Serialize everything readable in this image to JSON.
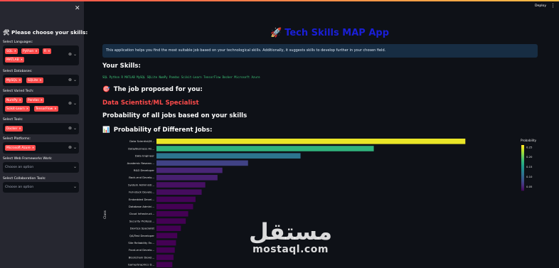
{
  "sidebar": {
    "close": "✕",
    "title_icon": "🛠",
    "title": "Please choose your skills:",
    "sections": [
      {
        "label": "Select Languages:",
        "tags": [
          "SQL",
          "Python",
          "R",
          "MATLAB"
        ]
      },
      {
        "label": "Select Databases:",
        "tags": [
          "MySQL",
          "SQLite"
        ]
      },
      {
        "label": "Select Varied Tech:",
        "tags": [
          "NumPy",
          "Pandas",
          "Scikit-Learn",
          "TensorFlow"
        ]
      },
      {
        "label": "Select Tools:",
        "tags": [
          "Docker"
        ]
      },
      {
        "label": "Select Platforms:",
        "tags": [
          "Microsoft Azure"
        ]
      },
      {
        "label": "Select Web Frameworks Work:",
        "placeholder": "Choose an option"
      },
      {
        "label": "Select Collaboration Tools:",
        "placeholder": "Choose an option"
      }
    ]
  },
  "header": {
    "deploy": "Deploy",
    "menu": "⋮"
  },
  "main": {
    "title_icon": "🚀",
    "title": "Tech Skills MAP App",
    "info": "This application helps you find the most suitable job based on your technological skills. Additionally, it suggests skills to develop further in your chosen field.",
    "your_skills_heading": "Your Skills:",
    "skills_line": "SQL  Python  R  MATLAB  MySQL  SQLite  NumPy  Pandas  Scikit-Learn  TensorFlow  Docker  Microsoft Azure",
    "proposed_icon": "🎯",
    "proposed_heading": "The job proposed for you:",
    "proposed_job": "Data Scientist/ML Specialist",
    "prob_heading": "Probability of all jobs based on your skills",
    "chart_icon": "📊",
    "chart_heading": "Probability of Different Jobs:"
  },
  "watermark": {
    "arabic": "مستقل",
    "latin": "mostaql.com"
  },
  "chart_data": {
    "type": "bar",
    "orientation": "horizontal",
    "ylabel": "Class",
    "legend_title": "Probability",
    "colorbar_ticks": [
      0.25,
      0.2,
      0.15,
      0.1,
      0.05
    ],
    "colorbar_labels": [
      "0.25",
      "0.20",
      "0.15",
      "0.10",
      "0.05"
    ],
    "colorbar_range": [
      0.03,
      0.26
    ],
    "xlim": [
      0,
      0.3
    ],
    "categories": [
      "Data Scientist/M...",
      "Data/Business An...",
      "Data Engineer",
      "Academic Researc...",
      "R&D Developer",
      "Back-end Develo...",
      "System Administr...",
      "Full-stack Develo...",
      "Embedded Devel...",
      "Database Admini...",
      "Cloud Infrastruct...",
      "Security Professi...",
      "DevOps Specialist",
      "QA/Test Developer",
      "Site Reliability En...",
      "Front-end Develo...",
      "Blockchain Devel...",
      "Game/Graphics D...",
      "Mobile Develo..."
    ],
    "values": [
      0.253,
      0.178,
      0.118,
      0.075,
      0.054,
      0.05,
      0.04,
      0.037,
      0.032,
      0.03,
      0.026,
      0.024,
      0.02,
      0.017,
      0.016,
      0.015,
      0.014,
      0.013,
      0.012
    ]
  }
}
